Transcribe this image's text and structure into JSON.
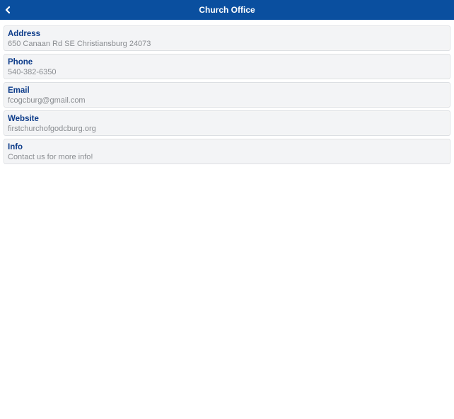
{
  "header": {
    "title": "Church Office",
    "back_icon": "chevron-left-icon",
    "color": "#0a4f9f"
  },
  "items": [
    {
      "label": "Address",
      "value": "650 Canaan Rd SE Christiansburg 24073"
    },
    {
      "label": "Phone",
      "value": "540-382-6350"
    },
    {
      "label": "Email",
      "value": "fcogcburg@gmail.com"
    },
    {
      "label": "Website",
      "value": "firstchurchofgodcburg.org"
    },
    {
      "label": "Info",
      "value": "Contact us for more info!"
    }
  ]
}
